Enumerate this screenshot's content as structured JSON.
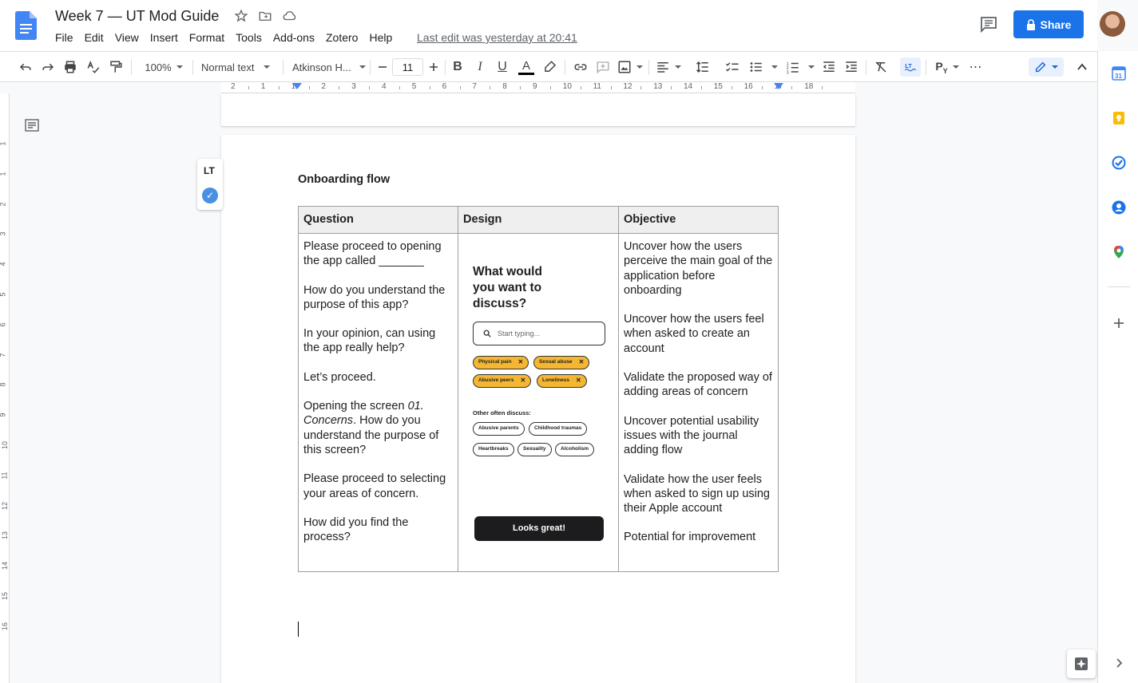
{
  "document": {
    "title": "Week 7 — UT Mod Guide",
    "last_edit": "Last edit was yesterday at 20:41"
  },
  "menu": [
    "File",
    "Edit",
    "View",
    "Insert",
    "Format",
    "Tools",
    "Add-ons",
    "Zotero",
    "Help"
  ],
  "header": {
    "share_label": "Share"
  },
  "toolbar": {
    "zoom": "100%",
    "style": "Normal text",
    "font": "Atkinson H...",
    "font_size": "11",
    "icons": [
      "undo-icon",
      "redo-icon",
      "print-icon",
      "spellcheck-icon",
      "paint-format-icon",
      "bold-icon",
      "italic-icon",
      "underline-icon",
      "text-color-icon",
      "highlight-icon",
      "link-icon",
      "comment-icon",
      "image-icon",
      "align-icon",
      "line-spacing-icon",
      "checklist-icon",
      "bullet-list-icon",
      "numbered-list-icon",
      "decrease-indent-icon",
      "increase-indent-icon",
      "clear-formatting-icon",
      "languagetool-icon",
      "ruler-icon",
      "more-icon",
      "editing-mode-icon",
      "collapse-icon"
    ]
  },
  "ruler": {
    "labels": [
      "2",
      "1",
      "1",
      "2",
      "3",
      "4",
      "5",
      "6",
      "7",
      "8",
      "9",
      "10",
      "11",
      "12",
      "13",
      "14",
      "15",
      "16",
      "17",
      "18"
    ]
  },
  "vertical_ruler": {
    "labels": [
      "1",
      "1",
      "2",
      "3",
      "4",
      "5",
      "6",
      "7",
      "8",
      "9",
      "10",
      "11",
      "12",
      "13",
      "14",
      "15",
      "16"
    ]
  },
  "languagetool_widget": {
    "logo_text": "LT"
  },
  "content": {
    "section_title": "Onboarding flow",
    "table": {
      "headers": [
        "Question",
        "Design",
        "Objective"
      ],
      "questions": [
        "Please proceed to opening the app called _______",
        "How do you understand the purpose of this app?",
        "In your opinion, can using the app really help?",
        "Let’s proceed.",
        "How did you find the process?"
      ],
      "q5_prefix": "Opening the screen ",
      "q5_italic": "01. Concerns",
      "q5_suffix": ". How do you understand the purpose of this screen?",
      "q6": "Please proceed to selecting your areas of concern.",
      "objectives": [
        "Uncover how the users perceive the main goal of the application before onboarding",
        "Uncover how the users feel when asked to create an account",
        "Validate the proposed way of adding areas of concern",
        "Uncover potential usability issues with the journal adding flow",
        "Validate how the user feels when asked to sign up using their Apple account",
        "Potential for improvement"
      ],
      "design": {
        "title": "What would you want to discuss?",
        "search_placeholder": "Start typing...",
        "selected_chips": [
          "Physical pain",
          "Sexual abuse",
          "Abusive peers",
          "Loneliness"
        ],
        "other_label": "Other often discuss:",
        "other_chips": [
          "Abusive parents",
          "Childhood traumas",
          "Heartbreaks",
          "Sexuality",
          "Alcoholism"
        ],
        "cta": "Looks great!",
        "chip_color": "#f5b731"
      }
    }
  },
  "colors": {
    "accent": "#1a73e8",
    "doc_blue": "#4285f4"
  },
  "side_panel": {
    "icons": [
      "calendar-icon",
      "keep-icon",
      "tasks-icon",
      "contacts-icon",
      "maps-icon",
      "add-icon"
    ],
    "calendar_day": "31"
  }
}
